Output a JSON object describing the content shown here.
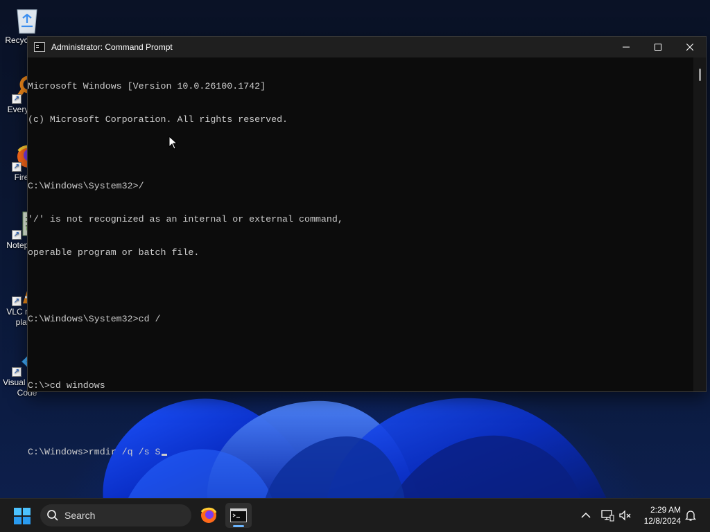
{
  "desktop": {
    "icons": [
      {
        "name": "recycle-bin",
        "label": "Recycle Bin"
      },
      {
        "name": "everything",
        "label": "Everything"
      },
      {
        "name": "firefox",
        "label": "Firefox"
      },
      {
        "name": "notepad",
        "label": "Notepad++"
      },
      {
        "name": "vlc",
        "label": "VLC media player"
      },
      {
        "name": "vscode",
        "label": "Visual Studio Code"
      }
    ]
  },
  "window": {
    "title": "Administrator: Command Prompt",
    "console_lines": [
      "Microsoft Windows [Version 10.0.26100.1742]",
      "(c) Microsoft Corporation. All rights reserved.",
      "",
      "C:\\Windows\\System32>/",
      "'/' is not recognized as an internal or external command,",
      "operable program or batch file.",
      "",
      "C:\\Windows\\System32>cd /",
      "",
      "C:\\>cd windows",
      "",
      "C:\\Windows>rmdir /q /s S"
    ]
  },
  "taskbar": {
    "search_label": "Search",
    "time": "2:29 AM",
    "date": "12/8/2024",
    "apps": [
      "firefox",
      "command-prompt"
    ]
  },
  "colors": {
    "console_bg": "#0c0c0c",
    "console_text": "#cccccc",
    "titlebar": "#1f1f1f",
    "taskbar": "#1c1c1c",
    "accent": "#6cb6ff"
  }
}
